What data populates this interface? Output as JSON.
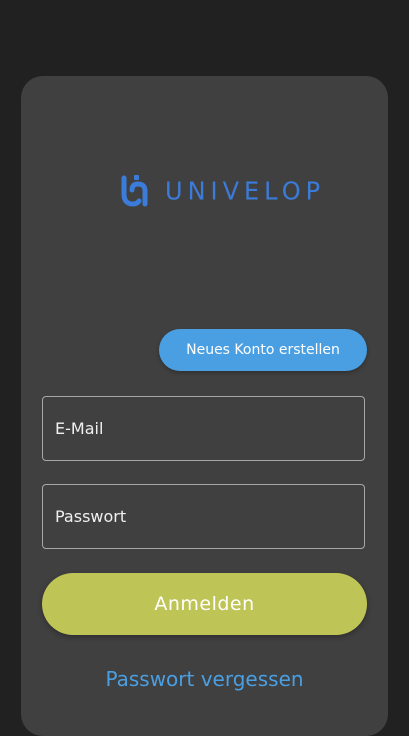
{
  "brand": {
    "name": "UNIVELOP",
    "logo_icon": "univelop-logo-icon",
    "primary_color": "#3b7bd9",
    "accent_color": "#4a9fe3"
  },
  "actions": {
    "create_account_label": "Neues Konto erstellen",
    "login_label": "Anmelden",
    "forgot_password_label": "Passwort vergessen"
  },
  "form": {
    "email_placeholder": "E-Mail",
    "email_value": "",
    "password_placeholder": "Passwort",
    "password_value": ""
  },
  "colors": {
    "background": "#212121",
    "card": "#404040",
    "login_button": "#bfc456",
    "link": "#4a9fe3"
  }
}
